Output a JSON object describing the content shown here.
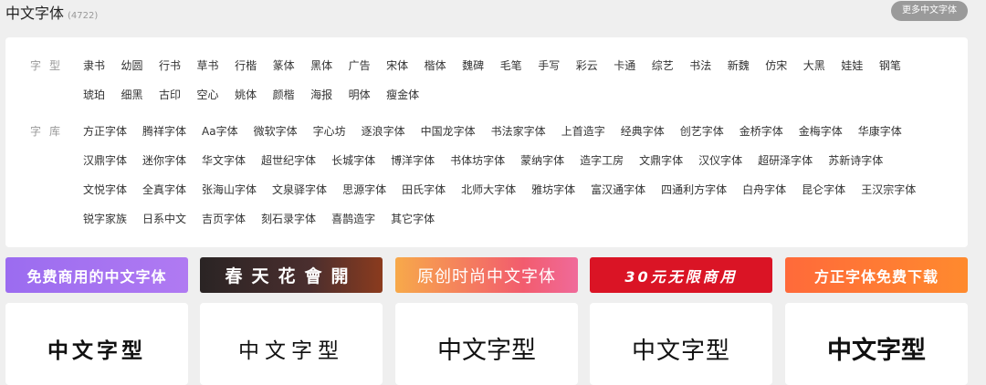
{
  "header": {
    "title": "中文字体",
    "count": "(4722)",
    "more_button": "更多中文字体"
  },
  "filters": {
    "style_label": "字型",
    "styles": [
      "隶书",
      "幼圆",
      "行书",
      "草书",
      "行楷",
      "篆体",
      "黑体",
      "广告",
      "宋体",
      "楷体",
      "魏碑",
      "毛笔",
      "手写",
      "彩云",
      "卡通",
      "综艺",
      "书法",
      "新魏",
      "仿宋",
      "大黑",
      "娃娃",
      "钢笔",
      "琥珀",
      "细黑",
      "古印",
      "空心",
      "姚体",
      "颜楷",
      "海报",
      "明体",
      "瘦金体"
    ],
    "library_label": "字库",
    "libraries": [
      "方正字体",
      "腾祥字体",
      "Aa字体",
      "微软字体",
      "字心坊",
      "逐浪字体",
      "中国龙字体",
      "书法家字体",
      "上首造字",
      "经典字体",
      "创艺字体",
      "金桥字体",
      "金梅字体",
      "华康字体",
      "汉鼎字体",
      "迷你字体",
      "华文字体",
      "超世纪字体",
      "长城字体",
      "博洋字体",
      "书体坊字体",
      "蒙纳字体",
      "造字工房",
      "文鼎字体",
      "汉仪字体",
      "超研泽字体",
      "苏新诗字体",
      "文悦字体",
      "全真字体",
      "张海山字体",
      "文泉驿字体",
      "思源字体",
      "田氏字体",
      "北师大字体",
      "雅坊字体",
      "富汉通字体",
      "四通利方字体",
      "白舟字体",
      "昆仑字体",
      "王汉宗字体",
      "锐字家族",
      "日系中文",
      "吉页字体",
      "刻石录字体",
      "喜鹊造字",
      "其它字体"
    ]
  },
  "banners": [
    {
      "label": "免费商用的中文字体"
    },
    {
      "label": "春天花會開"
    },
    {
      "label": "原创时尚中文字体"
    },
    {
      "label": "30元无限商用"
    },
    {
      "label": "方正字体免费下载"
    }
  ],
  "cards": [
    {
      "preview": "中文字型"
    },
    {
      "preview": "中文字型"
    },
    {
      "preview": "中文字型"
    },
    {
      "preview": "中文字型"
    },
    {
      "preview": "中文字型"
    }
  ],
  "colors": {
    "background": "#efefef",
    "panel": "#ffffff",
    "more_button": "#9a9a9a",
    "banner_purple": "#9b6cf0",
    "banner_dark": "#2a2424",
    "banner_pink": "#f25c6e",
    "banner_red": "#da1425",
    "banner_orange": "#ff6a3a"
  }
}
